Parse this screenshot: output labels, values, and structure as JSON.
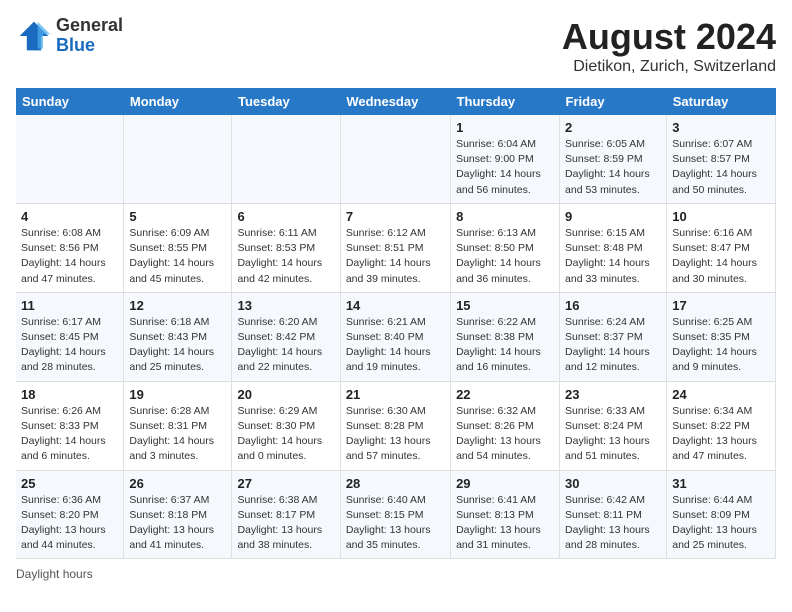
{
  "logo": {
    "general": "General",
    "blue": "Blue"
  },
  "title": "August 2024",
  "subtitle": "Dietikon, Zurich, Switzerland",
  "days_of_week": [
    "Sunday",
    "Monday",
    "Tuesday",
    "Wednesday",
    "Thursday",
    "Friday",
    "Saturday"
  ],
  "weeks": [
    [
      {
        "day": "",
        "info": ""
      },
      {
        "day": "",
        "info": ""
      },
      {
        "day": "",
        "info": ""
      },
      {
        "day": "",
        "info": ""
      },
      {
        "day": "1",
        "info": "Sunrise: 6:04 AM\nSunset: 9:00 PM\nDaylight: 14 hours and 56 minutes."
      },
      {
        "day": "2",
        "info": "Sunrise: 6:05 AM\nSunset: 8:59 PM\nDaylight: 14 hours and 53 minutes."
      },
      {
        "day": "3",
        "info": "Sunrise: 6:07 AM\nSunset: 8:57 PM\nDaylight: 14 hours and 50 minutes."
      }
    ],
    [
      {
        "day": "4",
        "info": "Sunrise: 6:08 AM\nSunset: 8:56 PM\nDaylight: 14 hours and 47 minutes."
      },
      {
        "day": "5",
        "info": "Sunrise: 6:09 AM\nSunset: 8:55 PM\nDaylight: 14 hours and 45 minutes."
      },
      {
        "day": "6",
        "info": "Sunrise: 6:11 AM\nSunset: 8:53 PM\nDaylight: 14 hours and 42 minutes."
      },
      {
        "day": "7",
        "info": "Sunrise: 6:12 AM\nSunset: 8:51 PM\nDaylight: 14 hours and 39 minutes."
      },
      {
        "day": "8",
        "info": "Sunrise: 6:13 AM\nSunset: 8:50 PM\nDaylight: 14 hours and 36 minutes."
      },
      {
        "day": "9",
        "info": "Sunrise: 6:15 AM\nSunset: 8:48 PM\nDaylight: 14 hours and 33 minutes."
      },
      {
        "day": "10",
        "info": "Sunrise: 6:16 AM\nSunset: 8:47 PM\nDaylight: 14 hours and 30 minutes."
      }
    ],
    [
      {
        "day": "11",
        "info": "Sunrise: 6:17 AM\nSunset: 8:45 PM\nDaylight: 14 hours and 28 minutes."
      },
      {
        "day": "12",
        "info": "Sunrise: 6:18 AM\nSunset: 8:43 PM\nDaylight: 14 hours and 25 minutes."
      },
      {
        "day": "13",
        "info": "Sunrise: 6:20 AM\nSunset: 8:42 PM\nDaylight: 14 hours and 22 minutes."
      },
      {
        "day": "14",
        "info": "Sunrise: 6:21 AM\nSunset: 8:40 PM\nDaylight: 14 hours and 19 minutes."
      },
      {
        "day": "15",
        "info": "Sunrise: 6:22 AM\nSunset: 8:38 PM\nDaylight: 14 hours and 16 minutes."
      },
      {
        "day": "16",
        "info": "Sunrise: 6:24 AM\nSunset: 8:37 PM\nDaylight: 14 hours and 12 minutes."
      },
      {
        "day": "17",
        "info": "Sunrise: 6:25 AM\nSunset: 8:35 PM\nDaylight: 14 hours and 9 minutes."
      }
    ],
    [
      {
        "day": "18",
        "info": "Sunrise: 6:26 AM\nSunset: 8:33 PM\nDaylight: 14 hours and 6 minutes."
      },
      {
        "day": "19",
        "info": "Sunrise: 6:28 AM\nSunset: 8:31 PM\nDaylight: 14 hours and 3 minutes."
      },
      {
        "day": "20",
        "info": "Sunrise: 6:29 AM\nSunset: 8:30 PM\nDaylight: 14 hours and 0 minutes."
      },
      {
        "day": "21",
        "info": "Sunrise: 6:30 AM\nSunset: 8:28 PM\nDaylight: 13 hours and 57 minutes."
      },
      {
        "day": "22",
        "info": "Sunrise: 6:32 AM\nSunset: 8:26 PM\nDaylight: 13 hours and 54 minutes."
      },
      {
        "day": "23",
        "info": "Sunrise: 6:33 AM\nSunset: 8:24 PM\nDaylight: 13 hours and 51 minutes."
      },
      {
        "day": "24",
        "info": "Sunrise: 6:34 AM\nSunset: 8:22 PM\nDaylight: 13 hours and 47 minutes."
      }
    ],
    [
      {
        "day": "25",
        "info": "Sunrise: 6:36 AM\nSunset: 8:20 PM\nDaylight: 13 hours and 44 minutes."
      },
      {
        "day": "26",
        "info": "Sunrise: 6:37 AM\nSunset: 8:18 PM\nDaylight: 13 hours and 41 minutes."
      },
      {
        "day": "27",
        "info": "Sunrise: 6:38 AM\nSunset: 8:17 PM\nDaylight: 13 hours and 38 minutes."
      },
      {
        "day": "28",
        "info": "Sunrise: 6:40 AM\nSunset: 8:15 PM\nDaylight: 13 hours and 35 minutes."
      },
      {
        "day": "29",
        "info": "Sunrise: 6:41 AM\nSunset: 8:13 PM\nDaylight: 13 hours and 31 minutes."
      },
      {
        "day": "30",
        "info": "Sunrise: 6:42 AM\nSunset: 8:11 PM\nDaylight: 13 hours and 28 minutes."
      },
      {
        "day": "31",
        "info": "Sunrise: 6:44 AM\nSunset: 8:09 PM\nDaylight: 13 hours and 25 minutes."
      }
    ]
  ],
  "footer": "Daylight hours"
}
